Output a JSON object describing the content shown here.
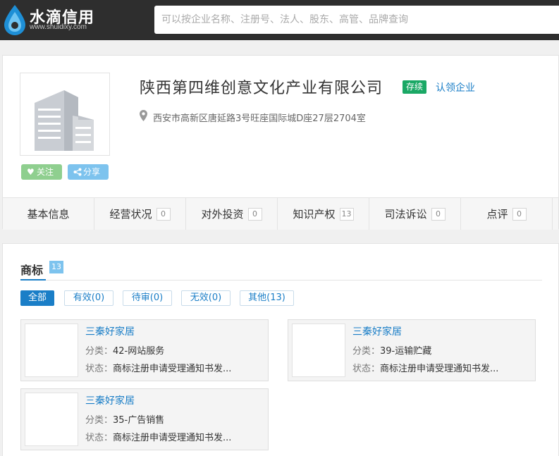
{
  "header": {
    "logo_text": "水滴信用",
    "logo_sub": "www.shuidixy.com",
    "search_placeholder": "可以按企业名称、注册号、法人、股东、高管、品牌查询"
  },
  "company": {
    "name": "陕西第四维创意文化产业有限公司",
    "status": "存续",
    "claim_label": "认领企业",
    "address": "西安市高新区唐延路3号旺座国际城D座27层2704室",
    "follow_label": "关注",
    "share_label": "分享"
  },
  "tabs": [
    {
      "label": "基本信息",
      "count": ""
    },
    {
      "label": "经营状况",
      "count": "0"
    },
    {
      "label": "对外投资",
      "count": "0"
    },
    {
      "label": "知识产权",
      "count": "13"
    },
    {
      "label": "司法诉讼",
      "count": "0"
    },
    {
      "label": "点评",
      "count": "0"
    }
  ],
  "trademarks": {
    "title": "商标",
    "count": "13",
    "filters": [
      "全部",
      "有效(0)",
      "待审(0)",
      "无效(0)",
      "其他(13)"
    ],
    "items": [
      {
        "name": "三秦好家居",
        "category_label": "分类：",
        "category": "42-网站服务",
        "status_label": "状态：",
        "status": "商标注册申请受理通知书发..."
      },
      {
        "name": "三秦好家居",
        "category_label": "分类：",
        "category": "39-运输贮藏",
        "status_label": "状态：",
        "status": "商标注册申请受理通知书发..."
      },
      {
        "name": "三秦好家居",
        "category_label": "分类：",
        "category": "35-广告销售",
        "status_label": "状态：",
        "status": "商标注册申请受理通知书发..."
      }
    ]
  },
  "colors": {
    "header_bg": "#2e2e2e",
    "accent": "#1a7ec7",
    "status_green": "#1aa865",
    "follow_green": "#8fcf8f",
    "share_blue": "#7dc3ee"
  },
  "icons": [
    "water-drop-logo-icon",
    "building-placeholder-icon",
    "heart-icon",
    "share-icon",
    "location-pin-icon"
  ]
}
